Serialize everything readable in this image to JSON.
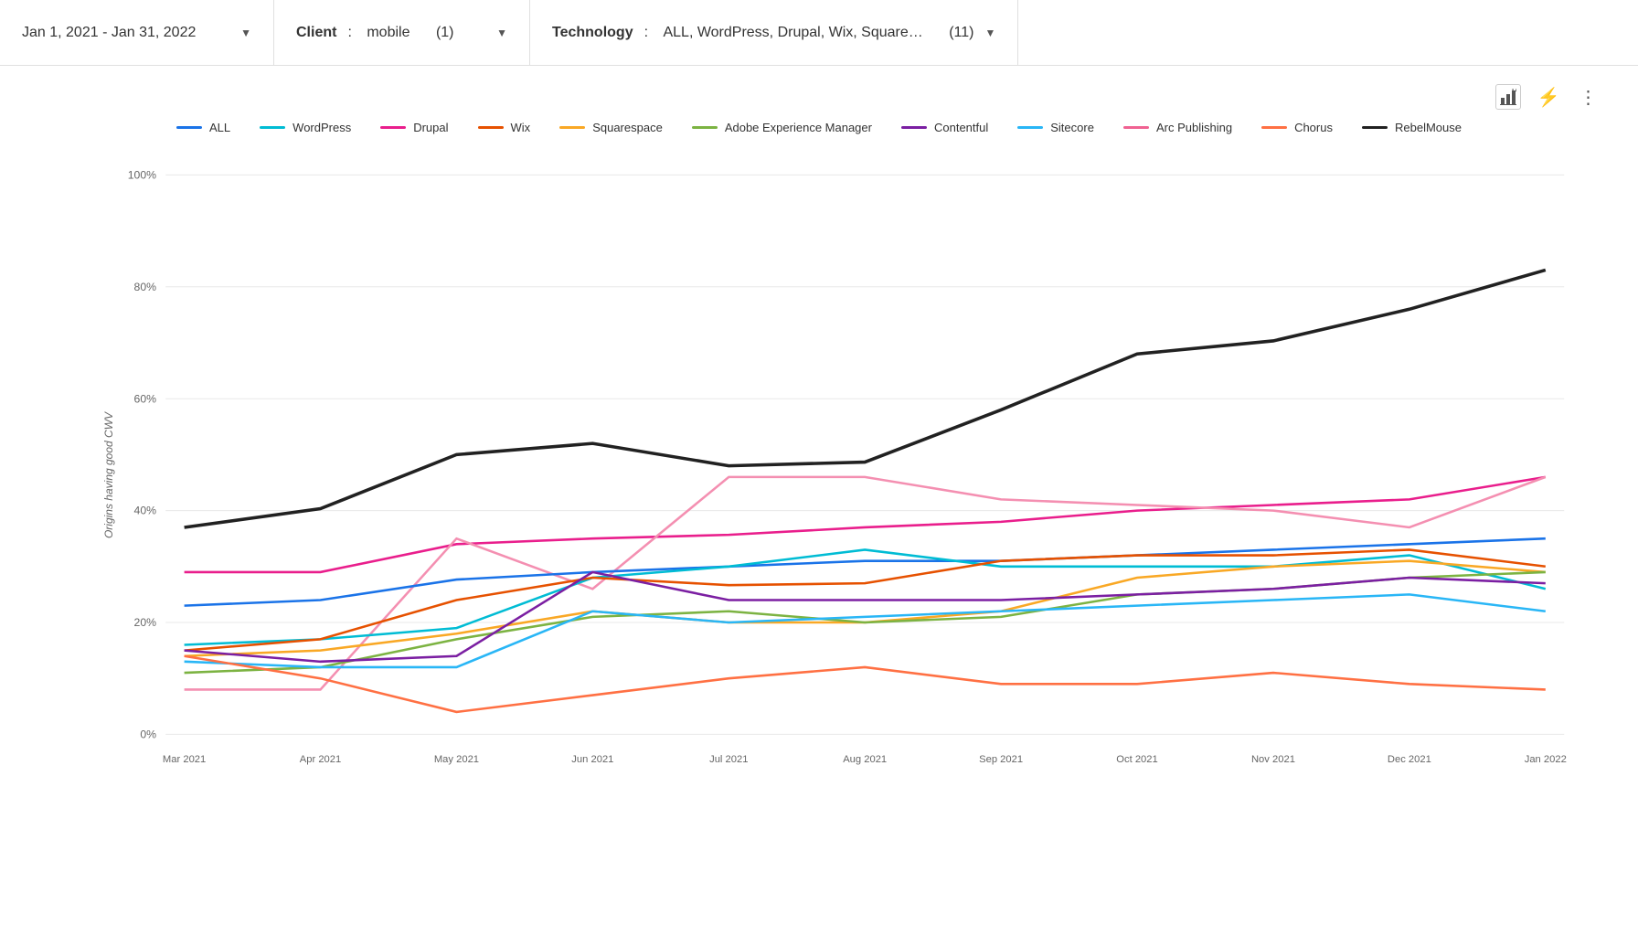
{
  "topbar": {
    "date_range": "Jan 1, 2021 - Jan 31, 2022",
    "client_label": "Client",
    "client_value": "mobile",
    "client_count": "(1)",
    "technology_label": "Technology",
    "technology_value": "ALL, WordPress, Drupal, Wix, Square…",
    "technology_count": "(11)"
  },
  "legend": {
    "items": [
      {
        "name": "ALL",
        "color": "#1a73e8"
      },
      {
        "name": "WordPress",
        "color": "#00bcd4"
      },
      {
        "name": "Drupal",
        "color": "#e91e8c"
      },
      {
        "name": "Wix",
        "color": "#e65100"
      },
      {
        "name": "Squarespace",
        "color": "#f9a825"
      },
      {
        "name": "Adobe Experience Manager",
        "color": "#7cb342"
      },
      {
        "name": "Contentful",
        "color": "#7b1fa2"
      },
      {
        "name": "Sitecore",
        "color": "#29b6f6"
      },
      {
        "name": "Arc Publishing",
        "color": "#f06292"
      },
      {
        "name": "Chorus",
        "color": "#ff7043"
      },
      {
        "name": "RebelMouse",
        "color": "#212121"
      }
    ]
  },
  "chart": {
    "y_axis": {
      "labels": [
        "100%",
        "80%",
        "60%",
        "40%",
        "20%",
        "0%"
      ]
    },
    "x_axis": {
      "labels": [
        "Mar 2021",
        "Apr 2021",
        "May 2021",
        "Jun 2021",
        "Jul 2021",
        "Aug 2021",
        "Sep 2021",
        "Oct 2021",
        "Nov 2021",
        "Dec 2021",
        "Jan 2022"
      ]
    },
    "y_axis_title": "Origins having good CWV"
  },
  "toolbar": {
    "chart_icon": "&#x2393;",
    "bolt_icon": "&#x26A1;",
    "more_icon": "&#x22EE;"
  }
}
